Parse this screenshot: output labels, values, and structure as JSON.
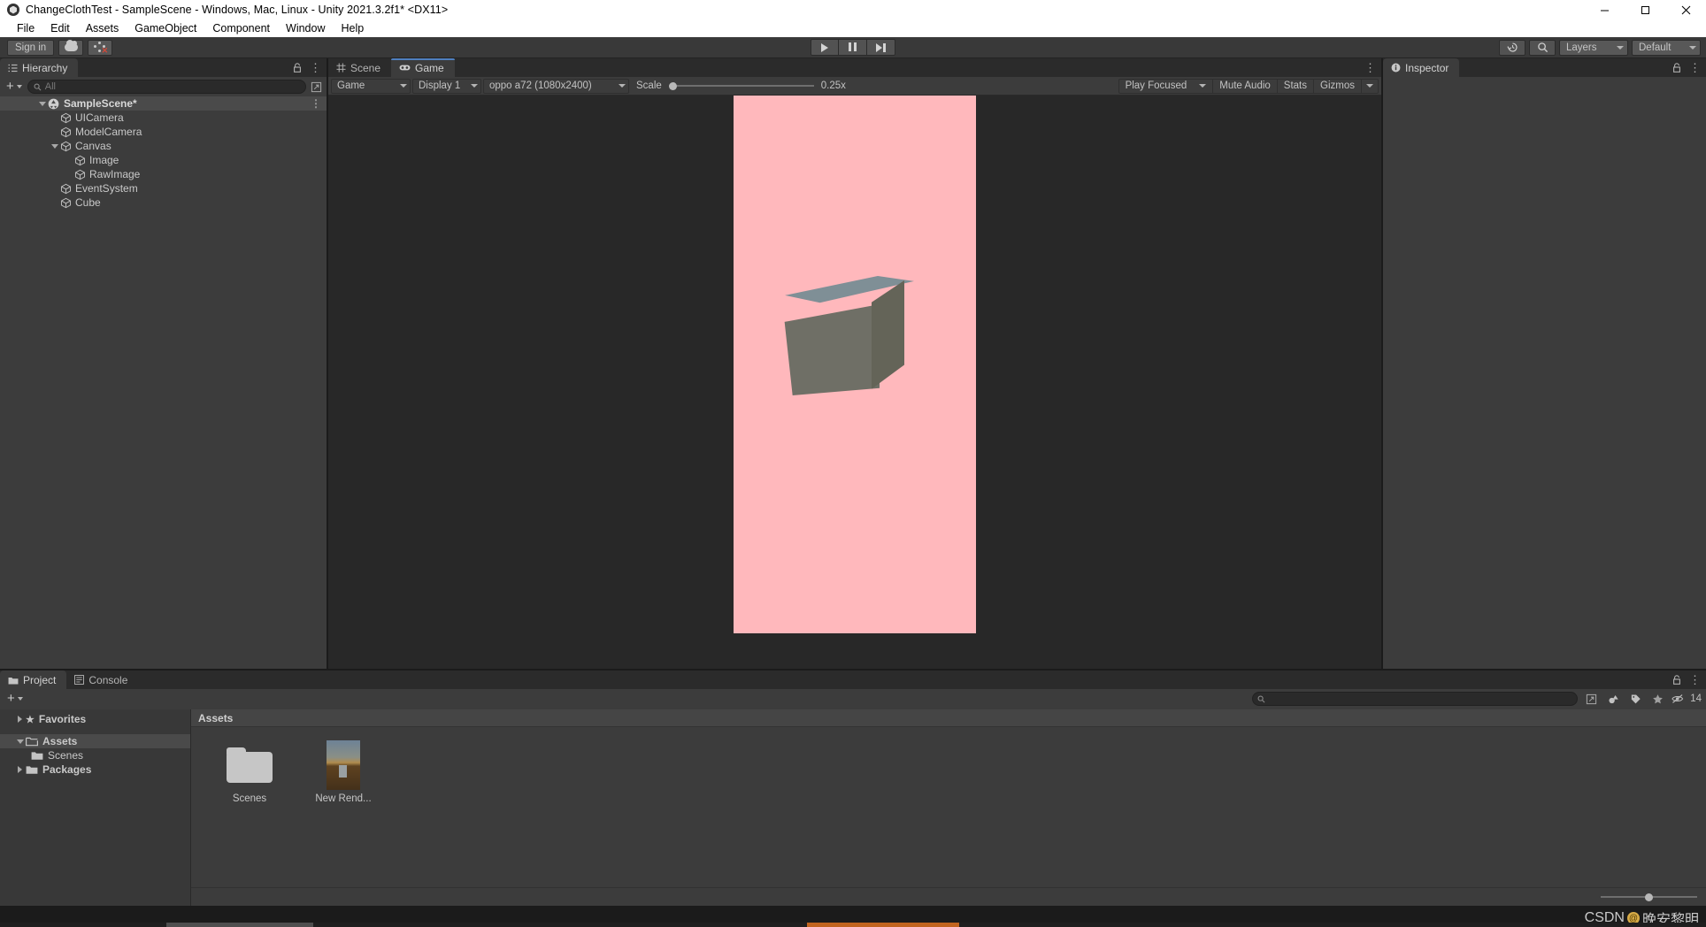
{
  "window": {
    "title": "ChangeClothTest - SampleScene - Windows, Mac, Linux - Unity 2021.3.2f1* <DX11>",
    "minimize_label": "minimize-icon",
    "maximize_label": "maximize-icon",
    "close_label": "close-icon"
  },
  "menubar": {
    "items": [
      "File",
      "Edit",
      "Assets",
      "GameObject",
      "Component",
      "Window",
      "Help"
    ]
  },
  "toolbar": {
    "signin_label": "Sign in",
    "cloud_icon": "cloud-icon",
    "collab_icon": "collab-icon",
    "play_icon": "play-icon",
    "pause_icon": "pause-icon",
    "step_icon": "step-icon",
    "history_icon": "history-icon",
    "search_icon": "search-icon",
    "layers_label": "Layers",
    "layout_label": "Default"
  },
  "hierarchy": {
    "tab_label": "Hierarchy",
    "tab_icon": "hierarchy-icon",
    "add_label": "+",
    "search_placeholder": "All",
    "search_icon": "search-icon",
    "lock_icon": "lock-icon",
    "menu_icon": "kebab-menu-icon",
    "tree": [
      {
        "label": "SampleScene*",
        "depth": 0,
        "icon": "scene-icon",
        "expanded": true,
        "selected": true
      },
      {
        "label": "UICamera",
        "depth": 1,
        "icon": "gameobject-icon",
        "expanded": null
      },
      {
        "label": "ModelCamera",
        "depth": 1,
        "icon": "gameobject-icon",
        "expanded": null
      },
      {
        "label": "Canvas",
        "depth": 1,
        "icon": "gameobject-icon",
        "expanded": true
      },
      {
        "label": "Image",
        "depth": 2,
        "icon": "gameobject-icon",
        "expanded": null
      },
      {
        "label": "RawImage",
        "depth": 2,
        "icon": "gameobject-icon",
        "expanded": null
      },
      {
        "label": "EventSystem",
        "depth": 1,
        "icon": "gameobject-icon",
        "expanded": null
      },
      {
        "label": "Cube",
        "depth": 1,
        "icon": "gameobject-icon",
        "expanded": null
      }
    ]
  },
  "gameview": {
    "tabs": [
      {
        "label": "Scene",
        "icon": "scene-grid-icon",
        "active": false
      },
      {
        "label": "Game",
        "icon": "gamepad-icon",
        "active": true
      }
    ],
    "view_mode": "Game",
    "display": "Display 1",
    "resolution": "oppo a72 (1080x2400)",
    "scale_label": "Scale",
    "scale_value": "0.25x",
    "play_mode": "Play Focused",
    "mute_audio": "Mute Audio",
    "stats": "Stats",
    "gizmos": "Gizmos",
    "canvas_bg_color": "#282828",
    "device_bg_color": "#ffb8bc",
    "cube_top_color": "#7f8f96",
    "cube_front_color": "#6f6f66",
    "cube_side_color": "#646458"
  },
  "inspector": {
    "tab_label": "Inspector",
    "tab_icon": "info-icon",
    "lock_icon": "lock-icon",
    "menu_icon": "kebab-menu-icon"
  },
  "project": {
    "tabs": [
      {
        "label": "Project",
        "icon": "folder-icon",
        "active": true
      },
      {
        "label": "Console",
        "icon": "console-icon",
        "active": false
      }
    ],
    "add_label": "+",
    "search_placeholder": "",
    "search_icon": "search-icon",
    "filter_type_icon": "filter-type-icon",
    "filter_label_icon": "filter-label-icon",
    "filter_favorite_icon": "star-icon",
    "hidden_count_icon": "eye-off-icon",
    "hidden_count": "14",
    "lock_icon": "lock-icon",
    "menu_icon": "kebab-menu-icon",
    "tree": [
      {
        "label": "Favorites",
        "depth": 0,
        "icon": "star-icon",
        "expanded": false,
        "selected": false,
        "bold": true
      },
      {
        "label": "Assets",
        "depth": 0,
        "icon": "folder-open-icon",
        "expanded": true,
        "selected": true,
        "bold": true
      },
      {
        "label": "Scenes",
        "depth": 1,
        "icon": "folder-icon",
        "expanded": null,
        "selected": false,
        "bold": false
      },
      {
        "label": "Packages",
        "depth": 0,
        "icon": "folder-icon",
        "expanded": false,
        "selected": false,
        "bold": true
      }
    ],
    "breadcrumb": "Assets",
    "assets": [
      {
        "label": "Scenes",
        "kind": "folder"
      },
      {
        "label": "New Rend...",
        "kind": "render-texture"
      }
    ]
  },
  "statusbar": {
    "watermark_prefix": "CSDN",
    "watermark_handle": "晚安黎明"
  }
}
